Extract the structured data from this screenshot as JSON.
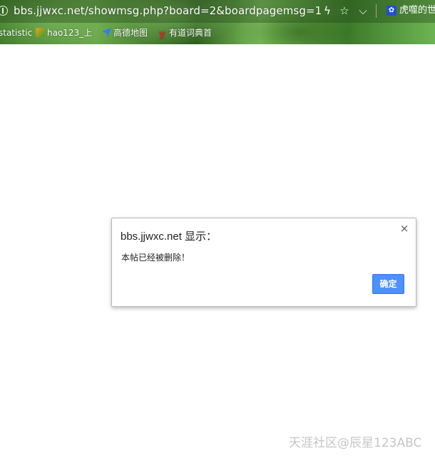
{
  "browser": {
    "url": "bbs.jjwxc.net/showmsg.php?board=2&boardpagemsg=1",
    "lead_icon": "info-circle-icon",
    "actions": [
      {
        "name": "lightning-icon",
        "glyph": "ϟ"
      },
      {
        "name": "star-icon",
        "glyph": "☆"
      },
      {
        "name": "chevron-down-icon",
        "glyph": "⌵"
      }
    ],
    "tab": {
      "favicon": "paw-icon",
      "title": "虎噬的世"
    }
  },
  "bookmarks": [
    {
      "label": "statistic",
      "icon": "none"
    },
    {
      "label": "hao123_上",
      "icon": "hao123-icon"
    },
    {
      "label": "高德地图",
      "icon": "gaode-map-icon"
    },
    {
      "label": "有道词典首",
      "icon": "youdao-icon",
      "glyph": "y"
    }
  ],
  "dialog": {
    "title": "bbs.jjwxc.net 显示：",
    "message": "本帖已经被删除！",
    "ok_label": "确定",
    "close_glyph": "×"
  },
  "watermark": "天涯社区@辰星123ABC",
  "colors": {
    "ok_button": "#4d90fe",
    "chrome_green": "#3f7a2a"
  }
}
